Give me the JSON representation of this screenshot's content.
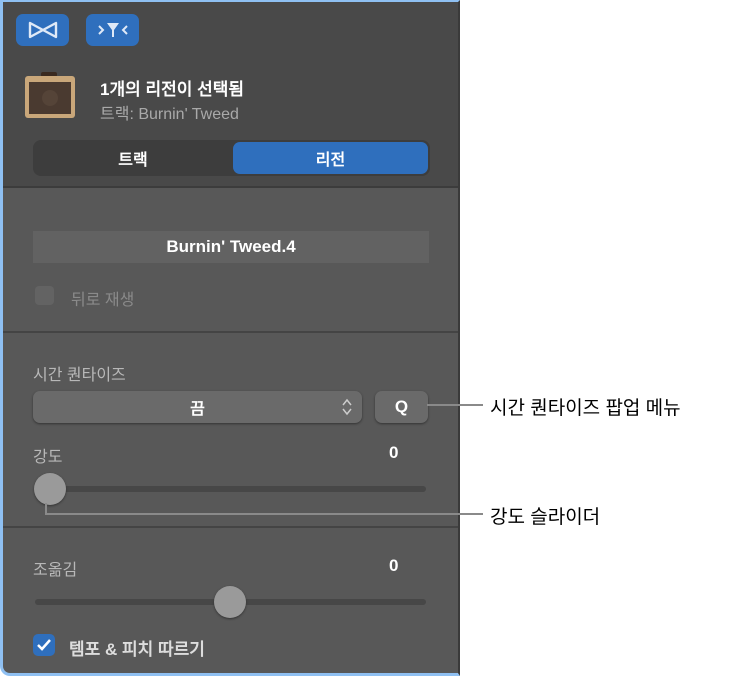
{
  "header": {
    "title": "1개의 리전이 선택됨",
    "subtitle": "트랙: Burnin' Tweed",
    "toolbar": [
      {
        "icon": "loop-icon"
      },
      {
        "icon": "filter-icon"
      }
    ]
  },
  "tabs": [
    {
      "label": "트랙",
      "selected": false
    },
    {
      "label": "리전",
      "selected": true
    }
  ],
  "region": {
    "name": "Burnin' Tweed.4",
    "reverse_label": "뒤로 재생",
    "reverse_checked": false
  },
  "quantize": {
    "label": "시간 퀀타이즈",
    "value": "끔",
    "q_label": "Q"
  },
  "strength": {
    "label": "강도",
    "value": "0",
    "fraction": 0
  },
  "swing": {
    "label": "조옮김",
    "value": "0",
    "fraction": 0.5
  },
  "follow": {
    "label": "템포 & 피치 따르기",
    "checked": true
  },
  "callouts": {
    "quantize": "시간 퀀타이즈 팝업 메뉴",
    "strength": "강도 슬라이더"
  },
  "colors": {
    "accent": "#2f6fbd",
    "panel": "#585858"
  }
}
